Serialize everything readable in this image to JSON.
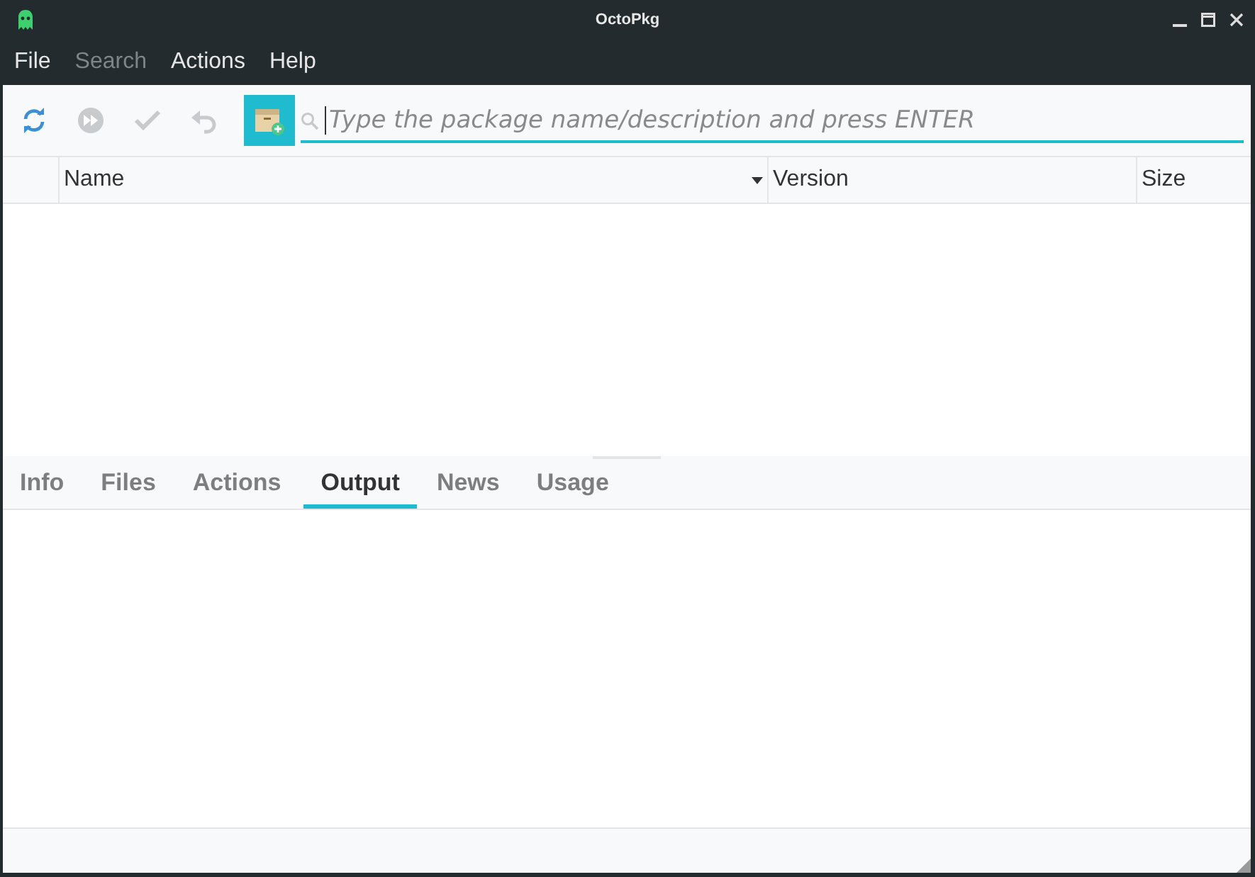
{
  "window": {
    "title": "OctoPkg"
  },
  "menu": [
    {
      "label": "File",
      "disabled": false
    },
    {
      "label": "Search",
      "disabled": true
    },
    {
      "label": "Actions",
      "disabled": false
    },
    {
      "label": "Help",
      "disabled": false
    }
  ],
  "toolbar": [
    {
      "kind": "sync",
      "disabled": false
    },
    {
      "kind": "forward",
      "disabled": true
    },
    {
      "kind": "check",
      "disabled": true
    },
    {
      "kind": "undo",
      "disabled": true
    },
    {
      "kind": "package",
      "disabled": false
    }
  ],
  "search": {
    "placeholder": "Type the package name/description and press ENTER"
  },
  "table": {
    "columns": [
      {
        "label": "Name",
        "sorted": true
      },
      {
        "label": "Version",
        "sorted": false
      },
      {
        "label": "Size",
        "sorted": false
      }
    ]
  },
  "tabs": [
    {
      "label": "Info",
      "selected": false
    },
    {
      "label": "Files",
      "selected": false
    },
    {
      "label": "Actions",
      "selected": false
    },
    {
      "label": "Output",
      "selected": true
    },
    {
      "label": "News",
      "selected": false
    },
    {
      "label": "Usage",
      "selected": false
    }
  ]
}
